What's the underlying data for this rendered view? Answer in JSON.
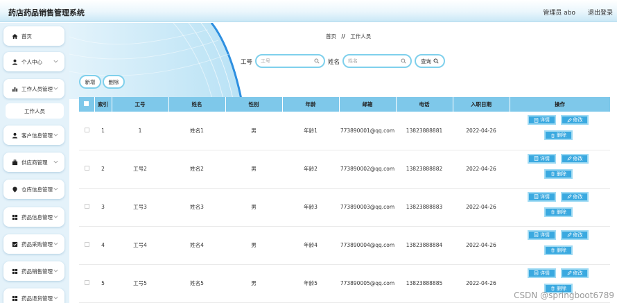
{
  "header": {
    "title": "药店药品销售管理系统",
    "admin": "管理员 abo",
    "logout": "退出登录"
  },
  "sidebar": {
    "items": [
      {
        "label": "首页",
        "icon": "home-icon",
        "expandable": false
      },
      {
        "label": "个人中心",
        "icon": "user-icon",
        "expandable": true
      },
      {
        "label": "工作人员管理",
        "icon": "bar-chart-icon",
        "expandable": true
      },
      {
        "label": "客户信息管理",
        "icon": "user-icon",
        "expandable": true
      },
      {
        "label": "供应商管理",
        "icon": "briefcase-icon",
        "expandable": true
      },
      {
        "label": "仓库信息管理",
        "icon": "location-pin-icon",
        "expandable": true
      },
      {
        "label": "药品信息管理",
        "icon": "grid-icon",
        "expandable": true
      },
      {
        "label": "药品采购管理",
        "icon": "checkbox-icon",
        "expandable": true
      },
      {
        "label": "药品销售管理",
        "icon": "grid-icon",
        "expandable": true
      },
      {
        "label": "药品退货管理",
        "icon": "grid-icon",
        "expandable": true
      }
    ],
    "subitem": "工作人员"
  },
  "breadcrumb": {
    "home": "首页",
    "separator": "//",
    "current": "工作人员"
  },
  "search": {
    "field1_label": "工号",
    "field1_placeholder": "工号",
    "field2_label": "姓名",
    "field2_placeholder": "姓名",
    "query_button": "查询"
  },
  "actions": {
    "add": "新增",
    "delete": "删除"
  },
  "table": {
    "columns": [
      "索引",
      "工号",
      "姓名",
      "性别",
      "年龄",
      "邮箱",
      "电话",
      "入职日期",
      "操作"
    ],
    "rows": [
      {
        "index": "1",
        "staff_no": "1",
        "name": "姓名1",
        "gender": "男",
        "age": "年龄1",
        "email": "773890001@qq.com",
        "phone": "13823888881",
        "hire_date": "2022-04-26"
      },
      {
        "index": "2",
        "staff_no": "工号2",
        "name": "姓名2",
        "gender": "男",
        "age": "年龄2",
        "email": "773890002@qq.com",
        "phone": "13823888882",
        "hire_date": "2022-04-26"
      },
      {
        "index": "3",
        "staff_no": "工号3",
        "name": "姓名3",
        "gender": "男",
        "age": "年龄3",
        "email": "773890003@qq.com",
        "phone": "13823888883",
        "hire_date": "2022-04-26"
      },
      {
        "index": "4",
        "staff_no": "工号4",
        "name": "姓名4",
        "gender": "男",
        "age": "年龄4",
        "email": "773890004@qq.com",
        "phone": "13823888884",
        "hire_date": "2022-04-26"
      },
      {
        "index": "5",
        "staff_no": "工号5",
        "name": "姓名5",
        "gender": "男",
        "age": "年龄5",
        "email": "773890005@qq.com",
        "phone": "13823888885",
        "hire_date": "2022-04-26"
      }
    ],
    "ops": {
      "detail": "详情",
      "edit": "修改",
      "delete": "删除"
    }
  },
  "watermark": "CSDN @springboot6789",
  "colors": {
    "accent": "#3aa9e0",
    "header_bg": "#7ec8ea",
    "border": "#7fd0ec",
    "sidebar_bg": "#e4f2fa"
  }
}
